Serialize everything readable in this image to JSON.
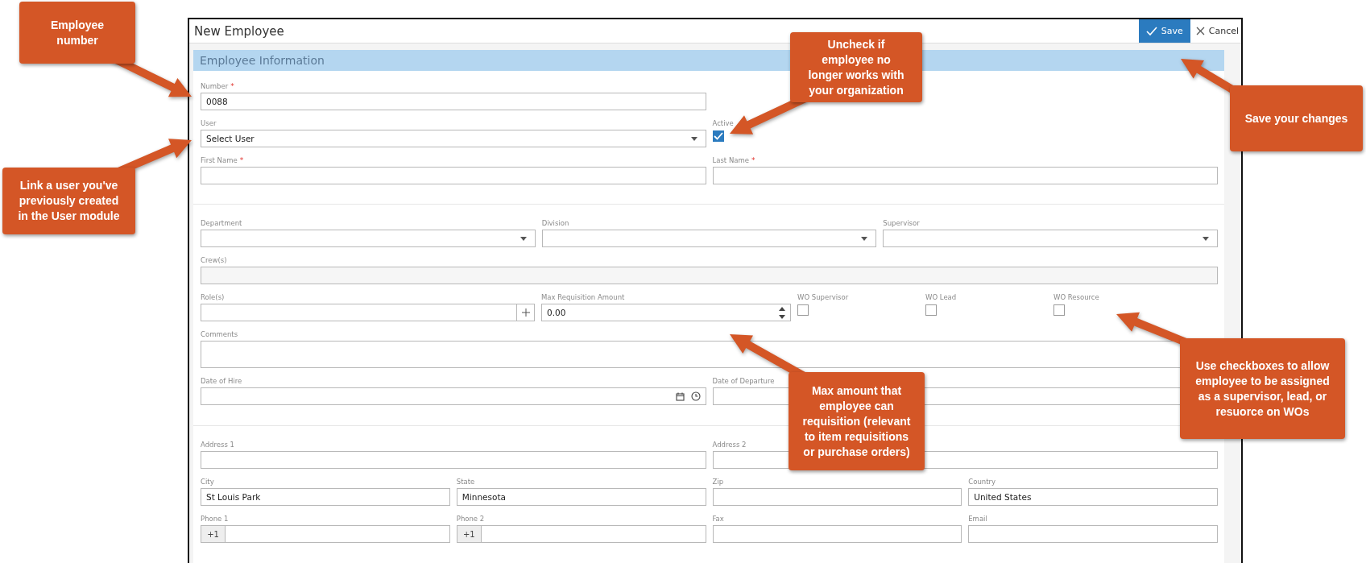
{
  "window": {
    "title": "New Employee"
  },
  "toolbar": {
    "buttons": [
      {
        "kind": "save",
        "label": "Save"
      },
      {
        "kind": "cancel",
        "label": "Cancel"
      }
    ]
  },
  "section": {
    "title": "Employee Information"
  },
  "groups": [
    {
      "rows": [
        {
          "fields": [
            {
              "kind": "text",
              "label": "Number",
              "required_mark": "*",
              "value": "0088"
            }
          ]
        },
        {
          "fields": [
            {
              "kind": "select",
              "label": "User",
              "value": "Select User"
            },
            {
              "kind": "checkbox",
              "label": "Active",
              "checked": true
            }
          ]
        },
        {
          "fields": [
            {
              "kind": "text",
              "label": "First Name",
              "required_mark": "*"
            },
            {
              "kind": "text",
              "label": "Last Name",
              "required_mark": "*"
            }
          ]
        }
      ]
    },
    {
      "rows": [
        {
          "fields": [
            {
              "kind": "select",
              "label": "Department"
            },
            {
              "kind": "select",
              "label": "Division"
            },
            {
              "kind": "select",
              "label": "Supervisor"
            }
          ]
        },
        {
          "fields": [
            {
              "kind": "text",
              "label": "Crew(s)",
              "disabled": true
            }
          ]
        },
        {
          "fields": [
            {
              "kind": "picker",
              "label": "Role(s)"
            },
            {
              "kind": "number",
              "label": "Max Requisition Amount",
              "value": "0.00"
            },
            {
              "kind": "checkbox",
              "label": "WO Supervisor",
              "checked": false
            },
            {
              "kind": "checkbox",
              "label": "WO Lead",
              "checked": false
            },
            {
              "kind": "checkbox",
              "label": "WO Resource",
              "checked": false
            }
          ]
        },
        {
          "fields": [
            {
              "kind": "textarea",
              "label": "Comments"
            }
          ]
        },
        {
          "fields": [
            {
              "kind": "date",
              "label": "Date of Hire"
            },
            {
              "kind": "text",
              "label": "Date of Departure"
            }
          ]
        }
      ]
    },
    {
      "rows": [
        {
          "fields": [
            {
              "kind": "text",
              "label": "Address 1"
            },
            {
              "kind": "text",
              "label": "Address 2"
            }
          ]
        },
        {
          "fields": [
            {
              "kind": "text",
              "label": "City",
              "value": "St Louis Park"
            },
            {
              "kind": "text",
              "label": "State",
              "value": "Minnesota"
            },
            {
              "kind": "text",
              "label": "Zip"
            },
            {
              "kind": "text",
              "label": "Country",
              "value": "United States"
            }
          ]
        },
        {
          "fields": [
            {
              "kind": "phone",
              "label": "Phone 1",
              "prefix": "+1"
            },
            {
              "kind": "phone",
              "label": "Phone 2",
              "prefix": "+1"
            },
            {
              "kind": "text",
              "label": "Fax"
            },
            {
              "kind": "text",
              "label": "Email"
            }
          ]
        }
      ]
    }
  ],
  "callouts": [
    {
      "text": "Employee number"
    },
    {
      "text": "Link a user you've previously created in the User module"
    },
    {
      "text": "Uncheck if employee no longer works with your organization"
    },
    {
      "text": "Save your changes"
    },
    {
      "text": "Max amount that employee can requisition (relevant to item requisitions or purchase orders)"
    },
    {
      "text": "Use checkboxes to allow employee to be assigned as a supervisor, lead, or resuorce on WOs"
    }
  ]
}
